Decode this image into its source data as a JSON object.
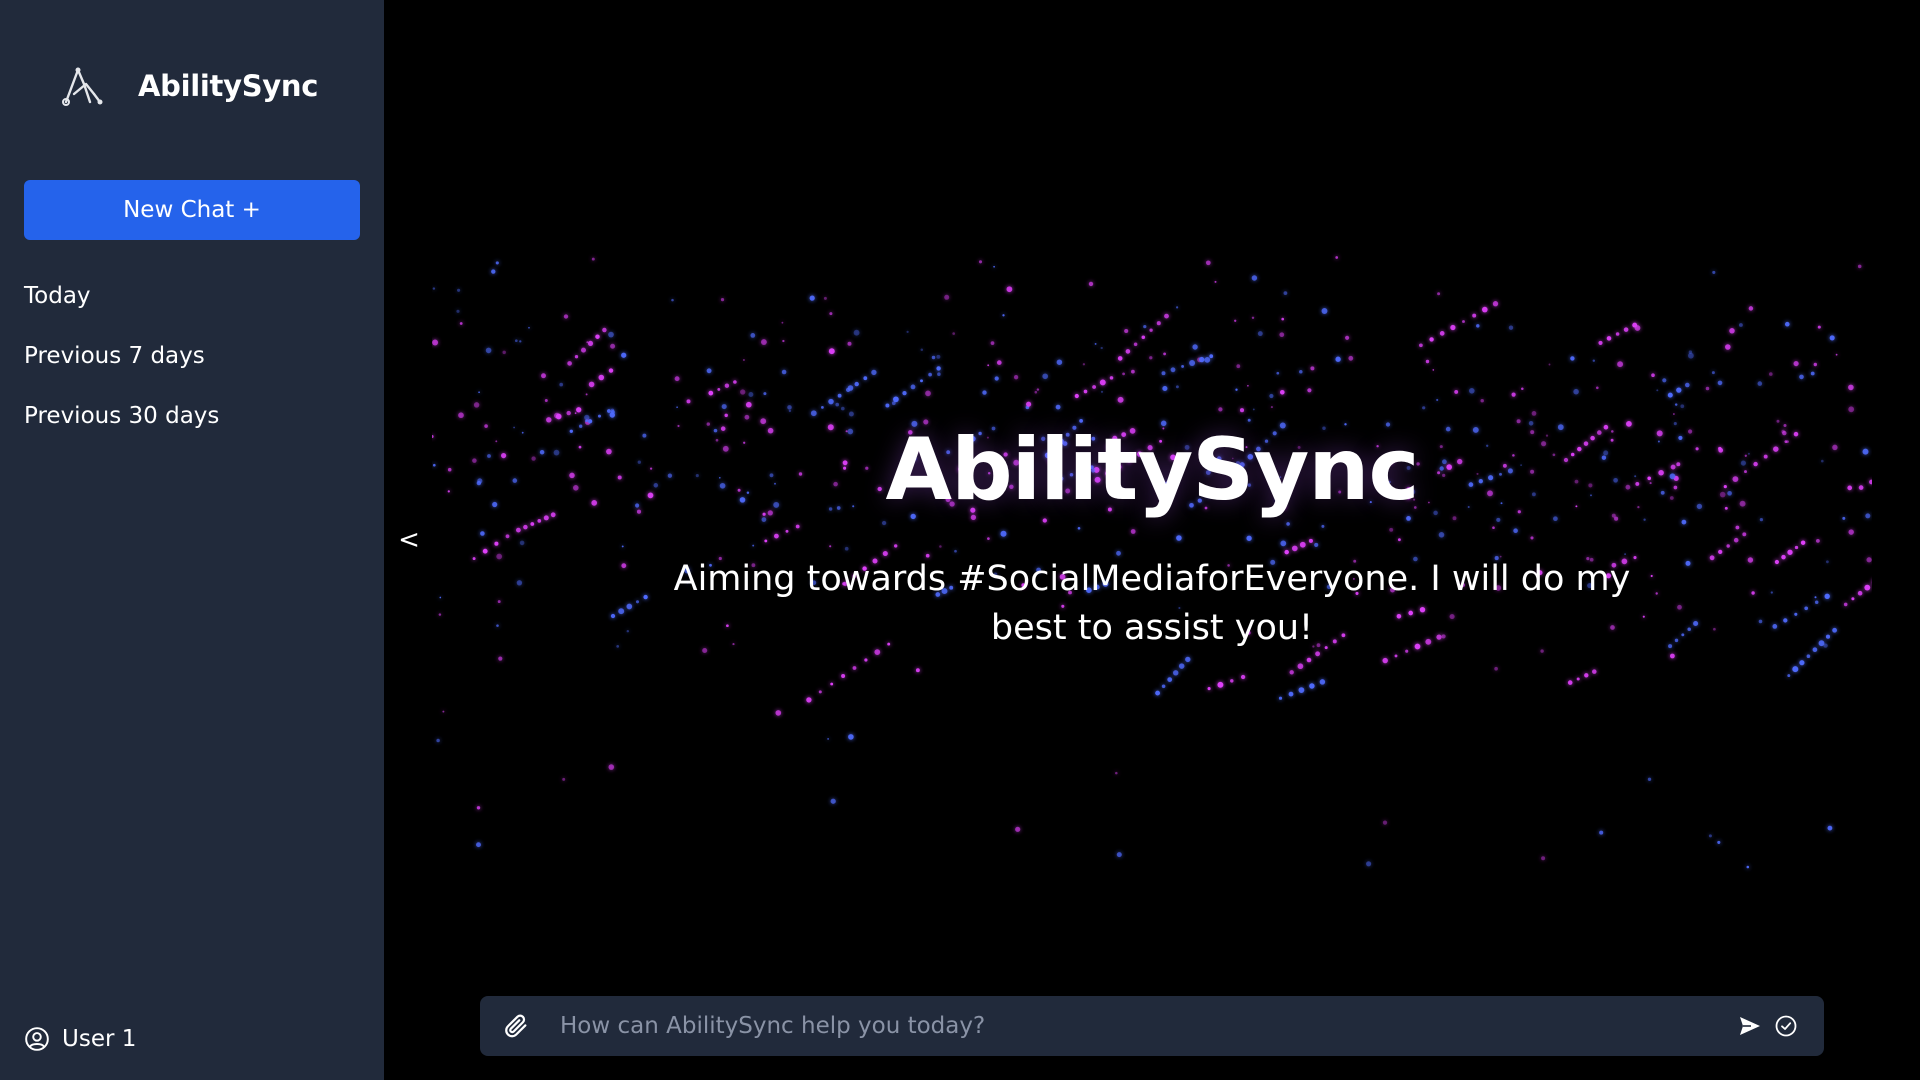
{
  "brand": {
    "name": "AbilitySync",
    "logo_icon": "abilitysync-logo-icon"
  },
  "sidebar": {
    "new_chat_label": "New Chat +",
    "history": [
      {
        "label": "Today"
      },
      {
        "label": "Previous 7 days"
      },
      {
        "label": "Previous 30 days"
      }
    ],
    "user": {
      "name": "User 1",
      "icon": "user-circle-icon"
    }
  },
  "main": {
    "collapse_label": "<",
    "title": "AbilitySync",
    "subtitle": "Aiming towards #SocialMediaforEveryone. I will do my best to assist you!"
  },
  "chatbar": {
    "placeholder": "How can AbilitySync help you today?",
    "value": "",
    "attach_icon": "paperclip-icon",
    "send_icon": "send-icon",
    "check_icon": "check-circle-icon"
  },
  "colors": {
    "sidebar_bg": "#212a3b",
    "accent": "#2563eb",
    "main_bg": "#000000",
    "particle_pink": "#e040fb",
    "particle_blue": "#4f6bff"
  }
}
